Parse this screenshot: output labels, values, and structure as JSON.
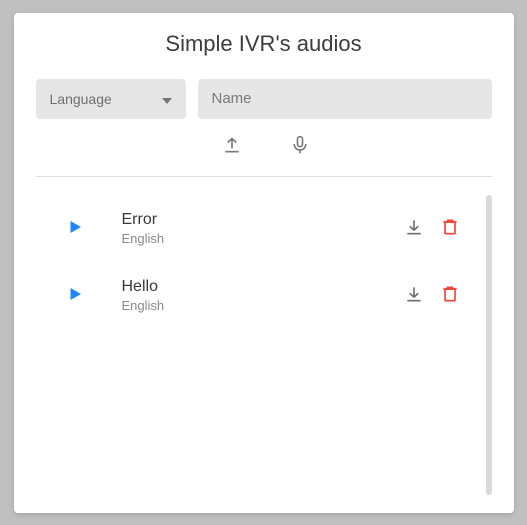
{
  "title": "Simple IVR's audios",
  "filters": {
    "language_label": "Language",
    "name_placeholder": "Name"
  },
  "toolbar": {
    "upload_icon": "upload-icon",
    "mic_icon": "mic-icon"
  },
  "audios": [
    {
      "title": "Error",
      "language": "English"
    },
    {
      "title": "Hello",
      "language": "English"
    }
  ],
  "icons": {
    "play": "play-icon",
    "download": "download-icon",
    "delete": "trash-icon",
    "caret": "chevron-down-icon"
  }
}
